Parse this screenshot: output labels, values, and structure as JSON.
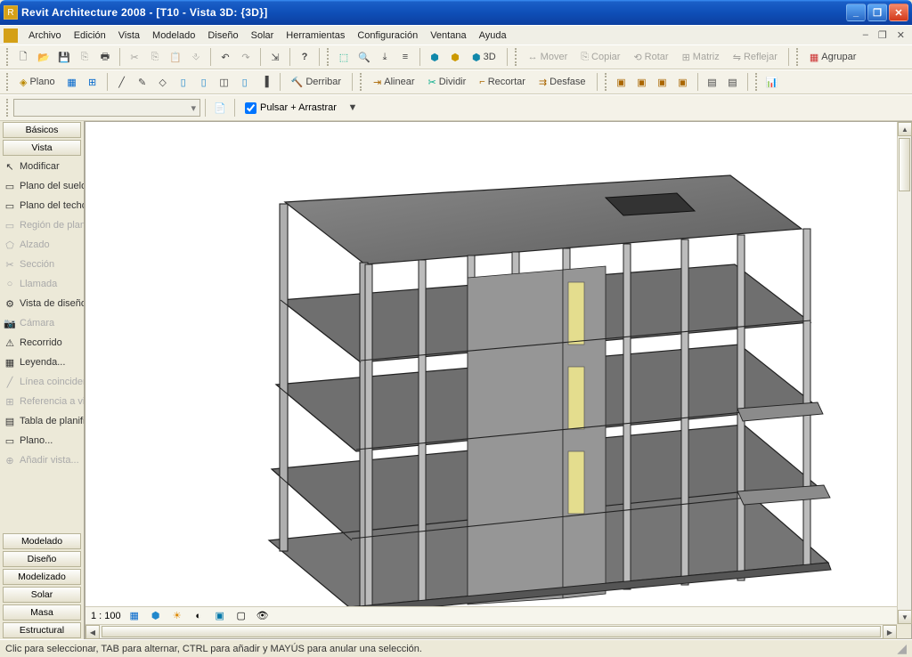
{
  "title": "Revit Architecture 2008 - [T10 - Vista 3D: {3D}]",
  "menu": [
    "Archivo",
    "Edición",
    "Vista",
    "Modelado",
    "Diseño",
    "Solar",
    "Herramientas",
    "Configuración",
    "Ventana",
    "Ayuda"
  ],
  "toolbar1": {
    "threed_label": "3D",
    "mover": "Mover",
    "copiar": "Copiar",
    "rotar": "Rotar",
    "matriz": "Matriz",
    "reflejar": "Reflejar",
    "agrupar": "Agrupar"
  },
  "toolbar2": {
    "plano": "Plano",
    "derribar": "Derribar",
    "alinear": "Alinear",
    "dividir": "Dividir",
    "recortar": "Recortar",
    "desfase": "Desfase"
  },
  "toolbar3": {
    "checkbox_label": "Pulsar + Arrastrar"
  },
  "designbar": {
    "top_sections": [
      "Básicos",
      "Vista"
    ],
    "tools": [
      {
        "label": "Modificar",
        "icon": "↖",
        "enabled": true
      },
      {
        "label": "Plano del suelo...",
        "icon": "▭",
        "enabled": true
      },
      {
        "label": "Plano del techo",
        "icon": "▭",
        "enabled": true
      },
      {
        "label": "Región de plano",
        "icon": "▭",
        "enabled": false
      },
      {
        "label": "Alzado",
        "icon": "⬠",
        "enabled": false
      },
      {
        "label": "Sección",
        "icon": "✂",
        "enabled": false
      },
      {
        "label": "Llamada",
        "icon": "○",
        "enabled": false
      },
      {
        "label": "Vista de diseño",
        "icon": "⚙",
        "enabled": true
      },
      {
        "label": "Cámara",
        "icon": "📷",
        "enabled": false
      },
      {
        "label": "Recorrido",
        "icon": "⚠",
        "enabled": true
      },
      {
        "label": "Leyenda...",
        "icon": "▦",
        "enabled": true
      },
      {
        "label": "Línea coincident",
        "icon": "╱",
        "enabled": false
      },
      {
        "label": "Referencia a vi",
        "icon": "⊞",
        "enabled": false
      },
      {
        "label": "Tabla de planifi",
        "icon": "▤",
        "enabled": true
      },
      {
        "label": "Plano...",
        "icon": "▭",
        "enabled": true
      },
      {
        "label": "Añadir vista...",
        "icon": "⊕",
        "enabled": false
      }
    ],
    "bottom_sections": [
      "Modelado",
      "Diseño",
      "Modelizado",
      "Solar",
      "Masa",
      "Estructural"
    ]
  },
  "viewcontrol": {
    "scale": "1 : 100"
  },
  "statusbar": "Clic para seleccionar, TAB para alternar, CTRL para añadir y MAYÚS para anular una selección."
}
